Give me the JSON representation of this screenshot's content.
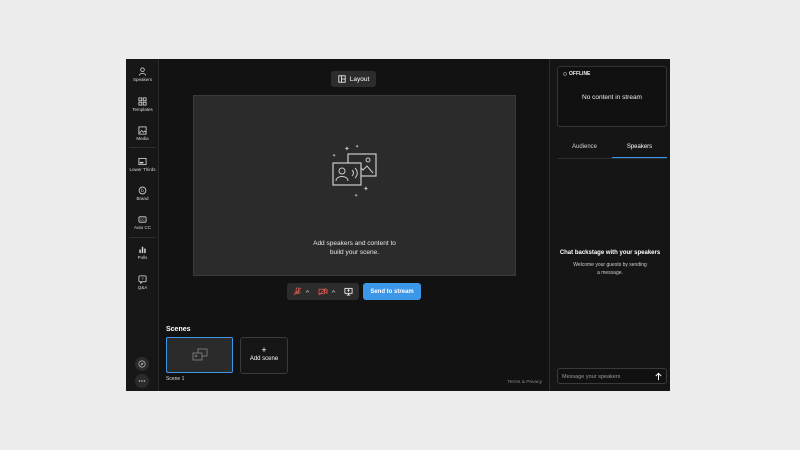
{
  "sidebar": {
    "items": [
      {
        "label": "Speakers",
        "icon": "person-icon"
      },
      {
        "label": "Templates",
        "icon": "grid-icon"
      },
      {
        "label": "Media",
        "icon": "image-icon"
      },
      {
        "label": "Lower Thirds",
        "icon": "lower-thirds-icon"
      },
      {
        "label": "Brand",
        "icon": "brand-icon"
      },
      {
        "label": "Auto CC",
        "icon": "cc-icon"
      },
      {
        "label": "Polls",
        "icon": "bar-chart-icon"
      },
      {
        "label": "Q&A",
        "icon": "qa-icon"
      }
    ],
    "footer_icons": [
      "compass-icon",
      "more-icon"
    ]
  },
  "main": {
    "layout_button": "Layout",
    "canvas_message_line1": "Add speakers and content to",
    "canvas_message_line2": "build your scene.",
    "send_to_stream": "Send to stream",
    "scenes_title": "Scenes",
    "scene_label": "Scene 1",
    "add_scene": "Add scene",
    "add_scene_plus": "+",
    "terms": "Terms & Privacy"
  },
  "right_panel": {
    "status": "OFFLINE",
    "no_content": "No content in stream",
    "tabs": [
      {
        "label": "Audience",
        "active": false
      },
      {
        "label": "Speakers",
        "active": true
      }
    ],
    "chat_title": "Chat backstage with your speakers",
    "chat_sub_line1": "Welcome your guests by sending",
    "chat_sub_line2": "a message.",
    "message_placeholder": "Message your speakers"
  },
  "colors": {
    "accent": "#3d97e8",
    "muted_red": "#e05a4a",
    "background": "#121212"
  }
}
